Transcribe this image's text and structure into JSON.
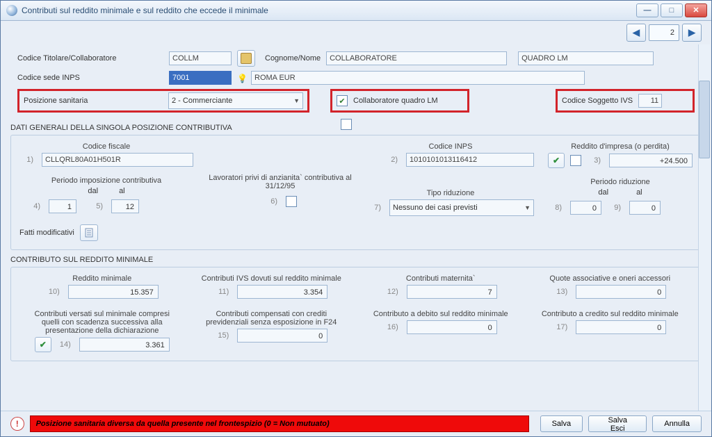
{
  "window": {
    "title": "Contributi sul reddito minimale e sul reddito che eccede il minimale"
  },
  "pager": {
    "page": "2"
  },
  "header": {
    "lbl_codice_titolare": "Codice Titolare/Collaboratore",
    "codice_titolare": "COLLM",
    "lbl_cognome": "Cognome/Nome",
    "cognome": "COLLABORATORE",
    "quadro": "QUADRO LM",
    "lbl_codice_sede": "Codice sede INPS",
    "codice_sede": "7001",
    "sede_descr": "ROMA EUR",
    "lbl_pos_sanitaria": "Posizione sanitaria",
    "pos_sanitaria": "2 - Commerciante",
    "chk_collab_label": "Collaboratore quadro LM",
    "lbl_codice_ivs": "Codice Soggetto IVS",
    "codice_ivs": "11"
  },
  "generali": {
    "title": "DATI GENERALI DELLA SINGOLA POSIZIONE CONTRIBUTIVA",
    "lbl_cf": "Codice fiscale",
    "cf": "CLLQRL80A01H501R",
    "lbl_inps": "Codice INPS",
    "inps": "1010101013116412",
    "lbl_reddito": "Reddito d'impresa (o perdita)",
    "reddito": "+24.500",
    "lbl_periodo_imp": "Periodo imposizione contributiva",
    "lbl_dal": "dal",
    "lbl_al": "al",
    "dal": "1",
    "al": "12",
    "lbl_lavoratori": "Lavoratori privi di anzianita` contributiva al 31/12/95",
    "lbl_tipo_rid": "Tipo riduzione",
    "tipo_rid": "Nessuno dei casi previsti",
    "lbl_periodo_rid": "Periodo riduzione",
    "rid_dal": "0",
    "rid_al": "0",
    "lbl_fatti": "Fatti modificativi",
    "n1": "1)",
    "n2": "2)",
    "n3": "3)",
    "n4": "4)",
    "n5": "5)",
    "n6": "6)",
    "n7": "7)",
    "n8": "8)",
    "n9": "9)"
  },
  "minimale": {
    "title": "CONTRIBUTO SUL REDDITO MINIMALE",
    "lbl10": "Reddito minimale",
    "v10": "15.357",
    "lbl11": "Contributi IVS dovuti sul reddito minimale",
    "v11": "3.354",
    "lbl12": "Contributi maternita`",
    "v12": "7",
    "lbl13": "Quote associative e oneri accessori",
    "v13": "0",
    "lbl14": "Contributi versati sul minimale compresi quelli con scadenza successiva alla presentazione della dichiarazione",
    "v14": "3.361",
    "lbl15": "Contributi compensati con crediti previdenziali senza esposizione in F24",
    "v15": "0",
    "lbl16": "Contributo a debito sul reddito minimale",
    "v16": "0",
    "lbl17": "Contributo a credito sul reddito minimale",
    "v17": "0",
    "n10": "10)",
    "n11": "11)",
    "n12": "12)",
    "n13": "13)",
    "n14": "14)",
    "n15": "15)",
    "n16": "16)",
    "n17": "17)"
  },
  "footer": {
    "error": "Posizione sanitaria diversa da quella presente nel frontespizio (0 = Non mutuato)",
    "salva": "Salva",
    "salva_esci": "Salva Esci",
    "annulla": "Annulla"
  }
}
